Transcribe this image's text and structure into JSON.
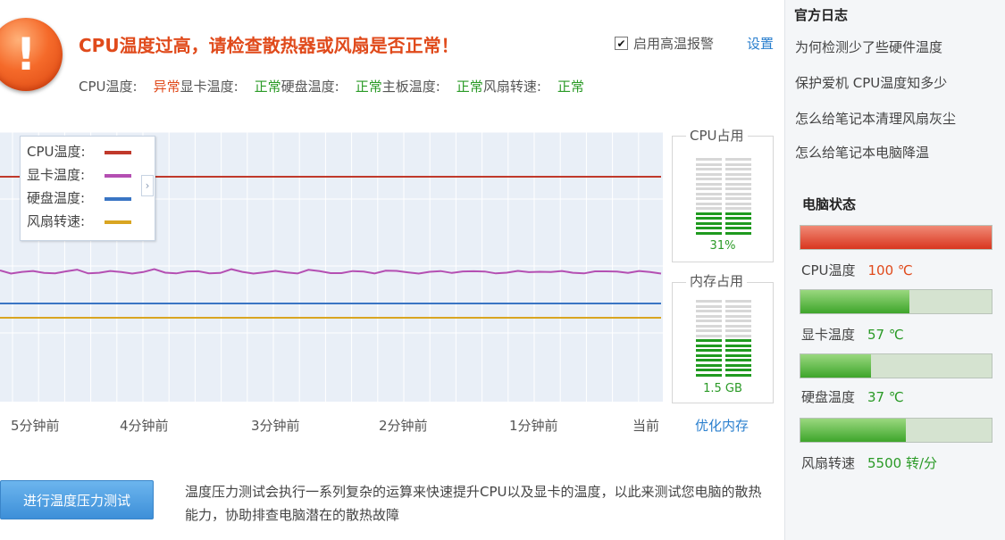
{
  "alert": {
    "icon": "warning-exclamation-icon",
    "title": "CPU温度过高，请检查散热器或风扇是否正常！",
    "enable_label": "启用高温报警",
    "enable_checked": true,
    "settings_label": "设置"
  },
  "status": [
    {
      "label": "CPU温度:",
      "value": "异常",
      "state": "bad"
    },
    {
      "label": "显卡温度:",
      "value": "正常",
      "state": "ok"
    },
    {
      "label": "硬盘温度:",
      "value": "正常",
      "state": "ok"
    },
    {
      "label": "主板温度:",
      "value": "正常",
      "state": "ok"
    },
    {
      "label": "风扇转速:",
      "value": "正常",
      "state": "ok"
    }
  ],
  "chart": {
    "legend": [
      {
        "name": "CPU温度:",
        "color": "#c0392b"
      },
      {
        "name": "显卡温度:",
        "color": "#b44fb2"
      },
      {
        "name": "硬盘温度:",
        "color": "#3a75c4"
      },
      {
        "name": "风扇转速:",
        "color": "#d9a521"
      }
    ],
    "x_labels": [
      "5分钟前",
      "4分钟前",
      "3分钟前",
      "2分钟前",
      "1分钟前",
      "当前"
    ]
  },
  "gauges": {
    "cpu": {
      "title": "CPU占用",
      "value": "31%",
      "fraction": 0.31
    },
    "memory": {
      "title": "内存占用",
      "value": "1.5 GB",
      "fraction": 0.48
    },
    "optimize_label": "优化内存"
  },
  "stress": {
    "button_label": "进行温度压力测试",
    "description": "温度压力测试会执行一系列复杂的运算来快速提升CPU以及显卡的温度，以此来测试您电脑的散热能力，协助排查电脑潜在的散热故障"
  },
  "sidebar": {
    "log_title": "官方日志",
    "log_items": [
      "为何检测少了些硬件温度",
      "保护爱机 CPU温度知多少",
      "怎么给笔记本清理风扇灰尘",
      "怎么给笔记本电脑降温"
    ],
    "state_title": "电脑状态",
    "bars": [
      {
        "label": "CPU温度",
        "value": "100 ℃",
        "fraction": 1.0,
        "state": "bad"
      },
      {
        "label": "显卡温度",
        "value": "57 ℃",
        "fraction": 0.57,
        "state": "ok"
      },
      {
        "label": "硬盘温度",
        "value": "37 ℃",
        "fraction": 0.37,
        "state": "ok"
      },
      {
        "label": "风扇转速",
        "value": "5500 转/分",
        "fraction": 0.55,
        "state": "ok"
      }
    ]
  },
  "chart_data": {
    "type": "line",
    "x": [
      "5分钟前",
      "4分钟前",
      "3分钟前",
      "2分钟前",
      "1分钟前",
      "当前"
    ],
    "series": [
      {
        "name": "CPU温度:",
        "values": [
          100,
          100,
          100,
          100,
          100,
          100
        ]
      },
      {
        "name": "显卡温度:",
        "values": [
          57,
          57,
          57,
          57,
          57,
          57
        ]
      },
      {
        "name": "硬盘温度:",
        "values": [
          37,
          37,
          37,
          37,
          37,
          37
        ]
      },
      {
        "name": "风扇转速:",
        "values": [
          5500,
          5500,
          5500,
          5500,
          5500,
          5500
        ]
      }
    ],
    "grid": true,
    "legend": "top-left"
  }
}
